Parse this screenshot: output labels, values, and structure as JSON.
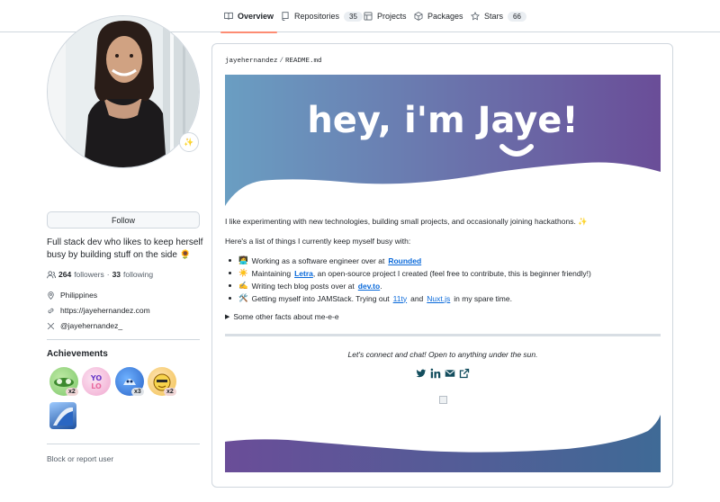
{
  "nav": {
    "tabs": [
      {
        "label": "Overview",
        "icon": "book-icon",
        "active": true
      },
      {
        "label": "Repositories",
        "icon": "repo-icon",
        "count": "35"
      },
      {
        "label": "Projects",
        "icon": "table-icon"
      },
      {
        "label": "Packages",
        "icon": "package-icon"
      },
      {
        "label": "Stars",
        "icon": "star-icon",
        "count": "66"
      }
    ]
  },
  "profile": {
    "status_emoji": "✨",
    "follow_label": "Follow",
    "bio": "Full stack dev who likes to keep herself busy by building stuff on the side 🌻",
    "followers_count": "264",
    "followers_label": "followers",
    "dot": "·",
    "following_count": "33",
    "following_label": "following",
    "location": "Philippines",
    "website": "https://jayehernandez.com",
    "twitter": "@jayehernandez_"
  },
  "achievements": {
    "title": "Achievements",
    "badges": [
      {
        "name": "pair-extraordinaire",
        "count": "x2"
      },
      {
        "name": "yolo",
        "count": ""
      },
      {
        "name": "pull-shark",
        "count": "x3"
      },
      {
        "name": "quickdraw",
        "count": "x2"
      },
      {
        "name": "arctic-code-vault",
        "count": ""
      }
    ]
  },
  "block_label": "Block or report user",
  "readme": {
    "user": "jayehernandez",
    "sep": "/",
    "file": "README.md",
    "banner_text": "hey, i'm Jaye!",
    "intro": "I like experimenting with new technologies, building small projects, and occasionally joining hackathons. ✨",
    "list_intro": "Here's a list of things I currently keep myself busy with:",
    "items": [
      {
        "emoji": "🧑‍💻",
        "pre": "Working as a software engineer over at",
        "link": "Rounded",
        "post": ""
      },
      {
        "emoji": "☀️",
        "pre": "Maintaining",
        "link": "Letra",
        "post": ", an open-source project I created (feel free to contribute, this is beginner friendly!)"
      },
      {
        "emoji": "✍️",
        "pre": "Writing tech blog posts over at",
        "link": "dev.to",
        "post": "."
      },
      {
        "emoji": "🛠️",
        "pre": "Getting myself into JAMStack. Trying out",
        "link": "11ty",
        "mid": "and",
        "link2": "Nuxt.js",
        "post": "in my spare time."
      }
    ],
    "details_label": "Some other facts about me-e-e",
    "connect": "Let's connect and chat! Open to anything under the sun.",
    "colors": {
      "banner_start": "#6a9ec2",
      "banner_end": "#6a4d98",
      "accent": "#0969da",
      "social": "#134e5e"
    }
  }
}
